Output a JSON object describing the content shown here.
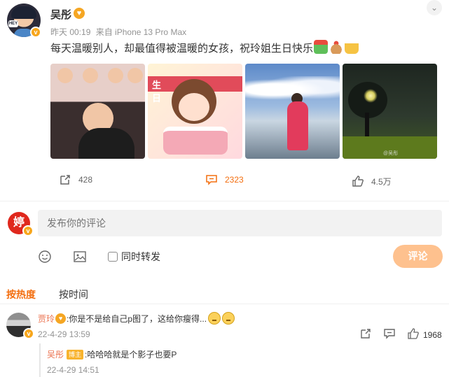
{
  "post": {
    "author": "吴彤",
    "author_badge_icon": "heart-crown-icon",
    "time": "昨天 00:19",
    "source": "来自 iPhone 13 Pro Max",
    "text": "每天温暖别人，却最值得被温暖的女孩，祝玲姐生日快乐！",
    "emojis": [
      "gift-icon",
      "cake-icon",
      "beer-icon"
    ],
    "photos": [
      {
        "name": "group-collage-photo"
      },
      {
        "name": "birthday-illustration-photo",
        "banner": "生日"
      },
      {
        "name": "mountain-sky-photo"
      },
      {
        "name": "night-tree-photo",
        "watermark": "@吴彤"
      }
    ],
    "reposts": "428",
    "comments": "2323",
    "likes": "4.5万"
  },
  "compose": {
    "avatar_text": "婷",
    "placeholder": "发布你的评论",
    "repost_label": "同时转发",
    "submit_label": "评论"
  },
  "sort": {
    "hot_label": "按热度",
    "time_label": "按时间"
  },
  "comment": {
    "author": "贾玲",
    "text": ":你是不是给自己p图了，这给你瘦得...",
    "time": "22-4-29 13:59",
    "likes": "1968"
  },
  "reply": {
    "author": "吴彤",
    "tag": "博主",
    "text": ":哈哈哈就是个影子也要P",
    "time": "22-4-29 14:51"
  },
  "colors": {
    "accent": "#f36e0f",
    "name_link": "#eb7350",
    "submit_bg": "#fec18e",
    "muted": "#939393"
  }
}
